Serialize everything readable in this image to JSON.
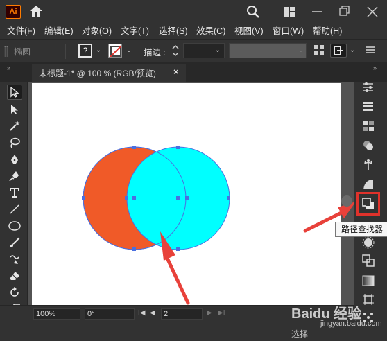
{
  "app": {
    "logo_text": "Ai"
  },
  "menu": [
    "文件(F)",
    "编辑(E)",
    "对象(O)",
    "文字(T)",
    "选择(S)",
    "效果(C)",
    "视图(V)",
    "窗口(W)",
    "帮助(H)"
  ],
  "control_bar": {
    "shape_name": "椭圆",
    "fill_icon_text": "?",
    "stroke_label": "描边 :",
    "dropdown_glyph": "⌄"
  },
  "document_tab": {
    "label": "未标题-1* @ 100 % (RGB/预览)",
    "close": "×"
  },
  "panel_collapse": "»",
  "tooltip": "路径查找器",
  "status_bar": {
    "zoom": "100%",
    "rotation": "0°",
    "artboard_number": "2",
    "first_btn": "I◀",
    "prev_btn": "◀",
    "next_btn": "▶",
    "last_btn": "▶I",
    "tool_mode": "选择"
  },
  "watermark": {
    "text": "Baidu 经验",
    "subtext": "jingyan.baidu.com"
  },
  "colors": {
    "left_circle_fill": "#f05a28",
    "right_circle_fill": "#00ffff",
    "selection": "#4a6fe0",
    "highlight_box": "#e0322b",
    "annotation_arrow": "#e8413a"
  }
}
